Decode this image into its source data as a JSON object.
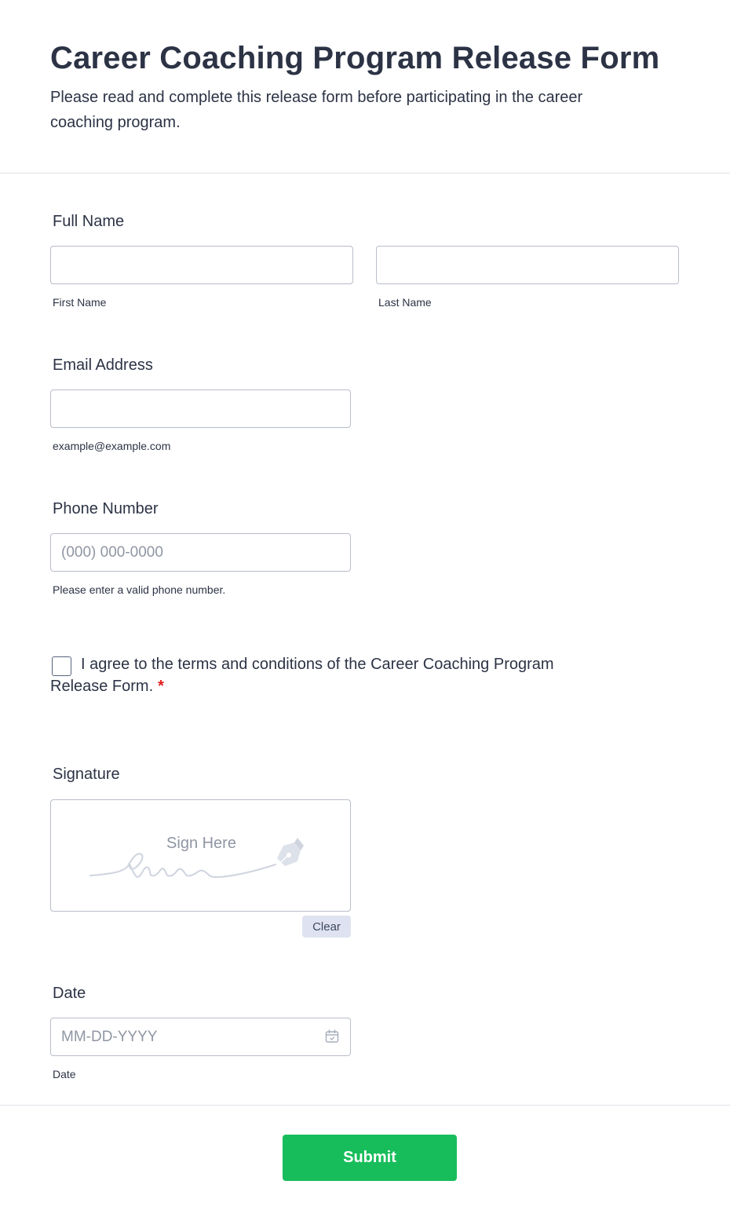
{
  "header": {
    "title": "Career Coaching Program Release Form",
    "description": "Please read and complete this release form before participating in the career coaching program."
  },
  "full_name": {
    "label": "Full Name",
    "first_sublabel": "First Name",
    "last_sublabel": "Last Name",
    "first_value": "",
    "last_value": ""
  },
  "email": {
    "label": "Email Address",
    "sublabel": "example@example.com",
    "value": ""
  },
  "phone": {
    "label": "Phone Number",
    "placeholder": "(000) 000-0000",
    "sublabel": "Please enter a valid phone number.",
    "value": ""
  },
  "terms": {
    "text": "I agree to the terms and conditions of the Career Coaching Program Release Form.",
    "required_mark": "*",
    "checked": false
  },
  "signature": {
    "label": "Signature",
    "pad_text": "Sign Here",
    "clear_label": "Clear"
  },
  "date": {
    "label": "Date",
    "placeholder": "MM-DD-YYYY",
    "sublabel": "Date",
    "icon": "calendar-icon"
  },
  "footer": {
    "submit_label": "Submit"
  },
  "colors": {
    "submit": "#18bd5b",
    "text": "#2c3345",
    "required": "#e11d1d",
    "border": "#b8bdc9"
  }
}
